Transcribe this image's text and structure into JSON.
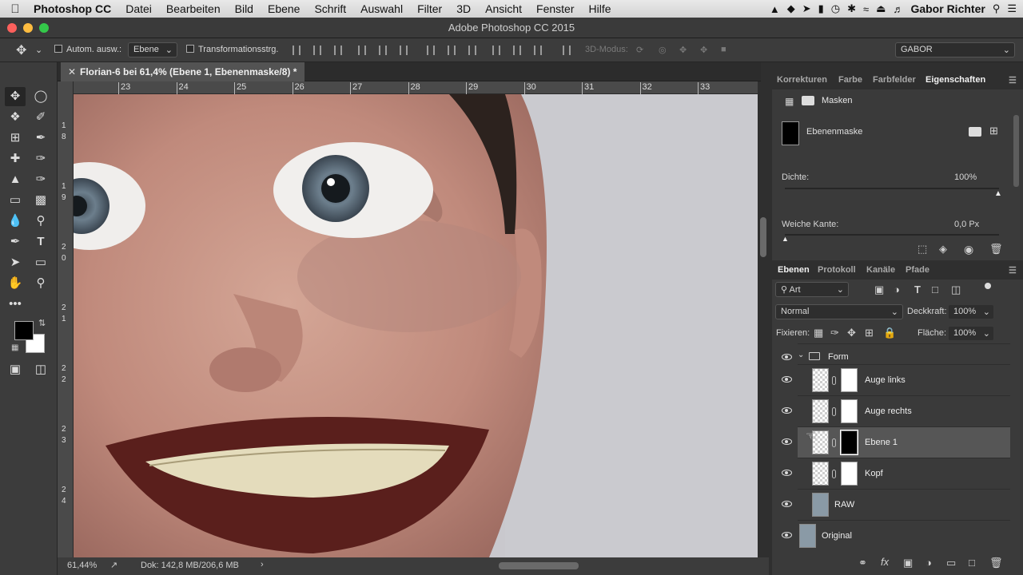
{
  "menubar": {
    "app": "Photoshop CC",
    "items": [
      "Datei",
      "Bearbeiten",
      "Bild",
      "Ebene",
      "Schrift",
      "Auswahl",
      "Filter",
      "3D",
      "Ansicht",
      "Fenster",
      "Hilfe"
    ],
    "user": "Gabor Richter"
  },
  "window": {
    "title": "Adobe Photoshop CC 2015"
  },
  "options": {
    "auto_select_label": "Autom. ausw.:",
    "auto_select_value": "Ebene",
    "transform_label": "Transformationsstrg.",
    "mode3d_label": "3D-Modus:",
    "workspace": "GABOR"
  },
  "document": {
    "tab_title": "Florian-6 bei 61,4% (Ebene 1, Ebenenmaske/8) *",
    "ruler_top": [
      "23",
      "24",
      "25",
      "26",
      "27",
      "28",
      "29",
      "30",
      "31",
      "32",
      "33"
    ],
    "ruler_left": [
      "1",
      "8",
      "1",
      "9",
      "2",
      "0",
      "2",
      "1",
      "2",
      "2",
      "2",
      "3",
      "2",
      "4"
    ],
    "zoom": "61,44%",
    "doc_size": "Dok: 142,8 MB/206,6 MB"
  },
  "properties": {
    "tabs": [
      "Korrekturen",
      "Farbe",
      "Farbfelder",
      "Eigenschaften"
    ],
    "active_tab": "Eigenschaften",
    "section": "Masken",
    "mask_label": "Ebenenmaske",
    "density_label": "Dichte:",
    "density_value": "100%",
    "density_level": 1.0,
    "feather_label": "Weiche Kante:",
    "feather_value": "0,0 Px",
    "feather_level": 0.0
  },
  "layers": {
    "tabs": [
      "Ebenen",
      "Protokoll",
      "Kanäle",
      "Pfade"
    ],
    "filter": "Art",
    "blend_mode": "Normal",
    "opacity_label": "Deckkraft:",
    "opacity_value": "100%",
    "lock_label": "Fixieren:",
    "fill_label": "Fläche:",
    "fill_value": "100%",
    "group": "Form",
    "rows": [
      {
        "name": "Auge links"
      },
      {
        "name": "Auge rechts"
      },
      {
        "name": "Ebene 1"
      },
      {
        "name": "Kopf"
      },
      {
        "name": "RAW"
      },
      {
        "name": "Original"
      }
    ]
  },
  "colors": {
    "foreground": "#000000",
    "background": "#ffffff",
    "selection": "#565656"
  }
}
